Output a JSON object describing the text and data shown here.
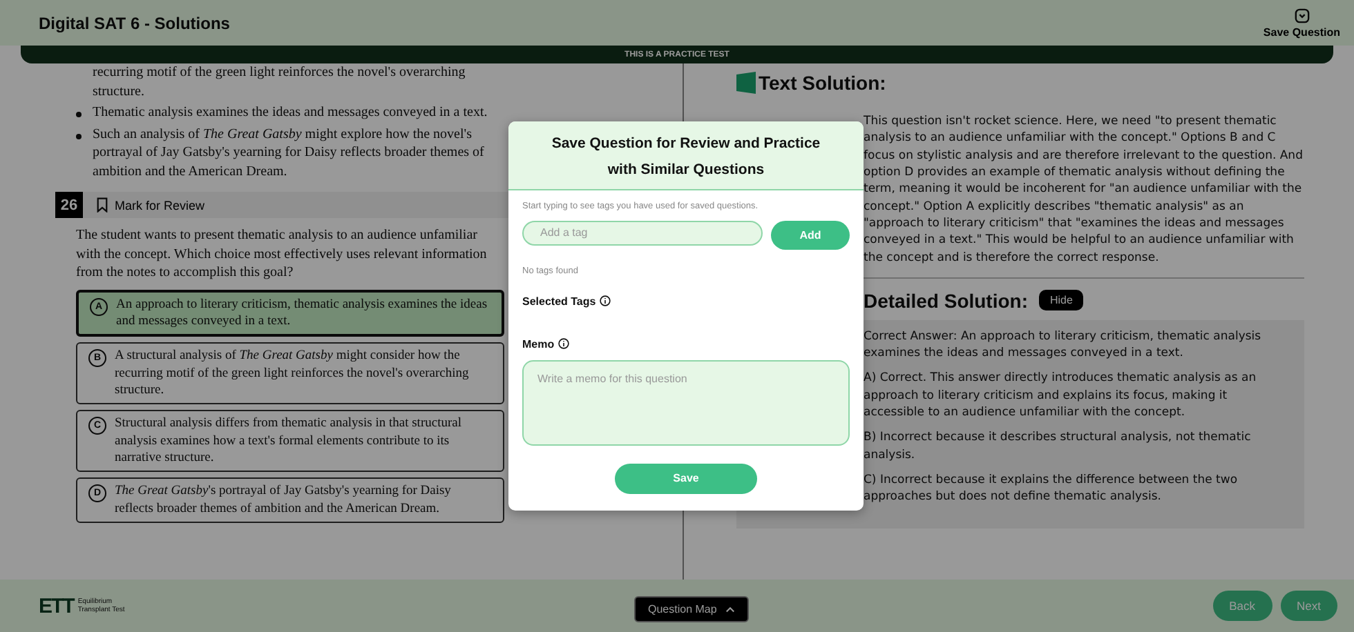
{
  "header": {
    "title": "Digital SAT 6 - Solutions",
    "save_label": "Save Question"
  },
  "banner": "THIS IS A PRACTICE TEST",
  "notes": [
    {
      "kind": "continuation",
      "text": "recurring motif of the green light reinforces the novel's overarching structure."
    },
    {
      "kind": "bullet",
      "text": "Thematic analysis examines the ideas and messages conveyed in a text."
    },
    {
      "kind": "bullet",
      "text": "Such an analysis of *The Great Gatsby* might explore how the novel's portrayal of Jay Gatsby's yearning for Daisy reflects broader themes of ambition and the American Dream."
    }
  ],
  "question": {
    "number": "26",
    "mark_label": "Mark for Review",
    "marked": false,
    "prompt": "The student wants to present thematic analysis to an audience unfamiliar with the concept. Which choice most effectively uses relevant information from the notes to accomplish this goal?",
    "choices": [
      {
        "letter": "A",
        "text": "An approach to literary criticism, thematic analysis examines the ideas and messages conveyed in a text.",
        "selected": true
      },
      {
        "letter": "B",
        "text": "A structural analysis of *The Great Gatsby* might consider how the recurring motif of the green light reinforces the novel's overarching structure.",
        "selected": false
      },
      {
        "letter": "C",
        "text": "Structural analysis differs from thematic analysis in that structural analysis examines how a text's formal elements contribute to its narrative structure.",
        "selected": false
      },
      {
        "letter": "D",
        "text": "*The Great Gatsby*'s portrayal of Jay Gatsby's yearning for Daisy reflects broader themes of ambition and the American Dream.",
        "selected": false
      }
    ]
  },
  "solution": {
    "title": "Text Solution:",
    "paragraph": "This question isn't rocket science. Here, we need \"to present thematic analysis to an audience unfamiliar with the concept.\" Options B and C focus on stylistic analysis and are therefore irrelevant to the question. And option D provides an example of thematic analysis without defining the term, meaning it would be incoherent for \"an audience unfamiliar with the concept.\" Option A explicitly describes \"thematic analysis\" as an \"approach to literary criticism\" that \"examines the ideas and messages conveyed in a text.\" This would be helpful to an audience unfamiliar with the concept and is therefore the correct response.",
    "detail_title": "Detailed Solution:",
    "hide_label": "Hide",
    "detail_items": [
      "Correct Answer: An approach to literary criticism, thematic analysis examines the ideas and messages conveyed in a text.",
      "A) Correct. This answer directly introduces thematic analysis as an approach to literary criticism and explains its focus, making it accessible to an audience unfamiliar with the concept.",
      "B) Incorrect because it describes structural analysis, not thematic analysis.",
      "C) Incorrect because it explains the difference between the two approaches but does not define thematic analysis."
    ]
  },
  "modal": {
    "title": "Save Question for Review and Practice with Similar Questions",
    "hint": "Start typing to see tags you have used for saved questions.",
    "tag_placeholder": "Add a tag",
    "add_label": "Add",
    "no_tags": "No tags found",
    "selected_tags_label": "Selected Tags",
    "memo_label": "Memo",
    "memo_placeholder": "Write a memo for this question",
    "save_label": "Save"
  },
  "footer": {
    "logo_letters": "ETT",
    "brand_line1": "Equilibrium",
    "brand_line2": "Transplant Test",
    "question_map": "Question Map",
    "back": "Back",
    "next": "Next"
  }
}
